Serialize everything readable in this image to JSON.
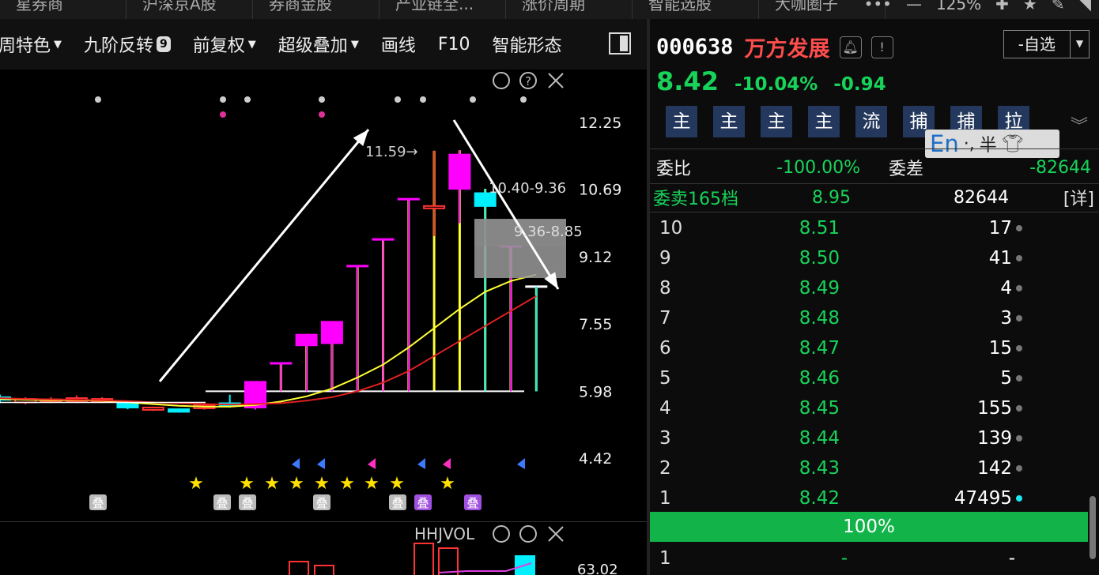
{
  "top_tabs": [
    "星券商",
    "沪深京A股",
    "券商金股",
    "产业链全...",
    "涨价周期",
    "智能选股",
    "大咖圈子"
  ],
  "top_controls": {
    "zoom": "125%"
  },
  "toolbar": {
    "items": [
      {
        "label": "周特色",
        "caret": true
      },
      {
        "label": "九阶反转",
        "badge": "9"
      },
      {
        "label": "前复权",
        "caret": true
      },
      {
        "label": "超级叠加",
        "caret": true
      },
      {
        "label": "画线"
      },
      {
        "label": "F10"
      },
      {
        "label": "智能形态"
      }
    ]
  },
  "chart": {
    "price_labels": [
      "12.25",
      "10.69",
      "9.12",
      "7.55",
      "5.98",
      "4.42"
    ],
    "annotations": {
      "high": "11.59→",
      "range1": "10.40-9.36",
      "range2": "9.36-8.85"
    },
    "overlay_char": "叠",
    "volume_title": "HHJVOL",
    "volume_label": "63.02"
  },
  "chart_data": {
    "type": "candlestick",
    "ylim": [
      4.42,
      12.25
    ],
    "candles": [
      {
        "o": 5.78,
        "c": 5.84,
        "h": 5.9,
        "l": 5.7,
        "col": "cyan"
      },
      {
        "o": 5.8,
        "c": 5.72,
        "h": 5.84,
        "l": 5.68,
        "col": "red"
      },
      {
        "o": 5.76,
        "c": 5.79,
        "h": 5.84,
        "l": 5.7,
        "col": "red"
      },
      {
        "o": 5.75,
        "c": 5.82,
        "h": 5.88,
        "l": 5.7,
        "col": "red"
      },
      {
        "o": 5.8,
        "c": 5.78,
        "h": 5.84,
        "l": 5.7,
        "col": "red"
      },
      {
        "o": 5.72,
        "c": 5.6,
        "h": 5.76,
        "l": 5.56,
        "col": "cyan"
      },
      {
        "o": 5.6,
        "c": 5.56,
        "h": 5.62,
        "l": 5.52,
        "col": "red"
      },
      {
        "o": 5.56,
        "c": 5.5,
        "h": 5.58,
        "l": 5.48,
        "col": "cyan"
      },
      {
        "o": 5.58,
        "c": 5.65,
        "h": 5.7,
        "l": 5.55,
        "col": "red"
      },
      {
        "o": 5.65,
        "c": 5.7,
        "h": 5.9,
        "l": 5.6,
        "col": "cyan"
      },
      {
        "o": 5.6,
        "c": 6.2,
        "h": 6.2,
        "l": 5.55,
        "col": "magenta"
      },
      {
        "o": 6.63,
        "c": 6.63,
        "h": 6.63,
        "l": 5.98,
        "col": "magenta"
      },
      {
        "o": 7.05,
        "c": 7.3,
        "h": 7.3,
        "l": 5.98,
        "col": "magenta"
      },
      {
        "o": 7.1,
        "c": 7.6,
        "h": 7.6,
        "l": 5.98,
        "col": "magenta"
      },
      {
        "o": 8.9,
        "c": 8.9,
        "h": 8.9,
        "l": 5.98,
        "col": "magenta"
      },
      {
        "o": 9.52,
        "c": 9.52,
        "h": 9.52,
        "l": 5.98,
        "col": "magenta"
      },
      {
        "o": 10.46,
        "c": 10.46,
        "h": 10.46,
        "l": 5.98,
        "col": "magenta"
      },
      {
        "o": 10.26,
        "c": 10.3,
        "h": 11.59,
        "l": 9.6,
        "col": "red"
      },
      {
        "o": 10.7,
        "c": 11.5,
        "h": 11.6,
        "l": 9.9,
        "col": "magenta"
      },
      {
        "o": 10.6,
        "c": 10.3,
        "h": 10.7,
        "l": 5.98,
        "col": "cyan"
      },
      {
        "o": 9.36,
        "c": 9.36,
        "h": 9.36,
        "l": 5.98,
        "col": "magenta"
      },
      {
        "o": 8.42,
        "c": 8.42,
        "h": 8.42,
        "l": 5.98,
        "col": "cyan"
      }
    ]
  },
  "stock": {
    "code": "000638",
    "name": "万方发展",
    "watch_label": "-自选",
    "price": "8.42",
    "change_pct": "-10.04%",
    "change": "-0.94",
    "tags": [
      "主",
      "主",
      "主",
      "主",
      "流",
      "捕",
      "捕",
      "拉"
    ]
  },
  "ime": {
    "mode": "En",
    "punct": "·,",
    "width": "半"
  },
  "weibi": {
    "label1": "委比",
    "value1": "-100.00%",
    "label2": "委差",
    "value2": "-82644"
  },
  "ask_summary": {
    "label": "委卖165档",
    "price": "8.95",
    "qty": "82644",
    "detail": "[详]"
  },
  "orderbook": [
    {
      "lvl": "10",
      "price": "8.51",
      "qty": "17"
    },
    {
      "lvl": "9",
      "price": "8.50",
      "qty": "41"
    },
    {
      "lvl": "8",
      "price": "8.49",
      "qty": "4"
    },
    {
      "lvl": "7",
      "price": "8.48",
      "qty": "3"
    },
    {
      "lvl": "6",
      "price": "8.47",
      "qty": "15"
    },
    {
      "lvl": "5",
      "price": "8.46",
      "qty": "5"
    },
    {
      "lvl": "4",
      "price": "8.45",
      "qty": "155"
    },
    {
      "lvl": "3",
      "price": "8.44",
      "qty": "139"
    },
    {
      "lvl": "2",
      "price": "8.43",
      "qty": "142"
    },
    {
      "lvl": "1",
      "price": "8.42",
      "qty": "47495"
    }
  ],
  "ratio_bar": "100%",
  "bid1": {
    "lvl": "1",
    "price": "-",
    "qty": "-"
  },
  "colors": {
    "up": "#ff3333",
    "down": "#18d35a",
    "magenta": "#ff00ff",
    "cyan": "#00f0ff",
    "yellow": "#ffff33"
  }
}
